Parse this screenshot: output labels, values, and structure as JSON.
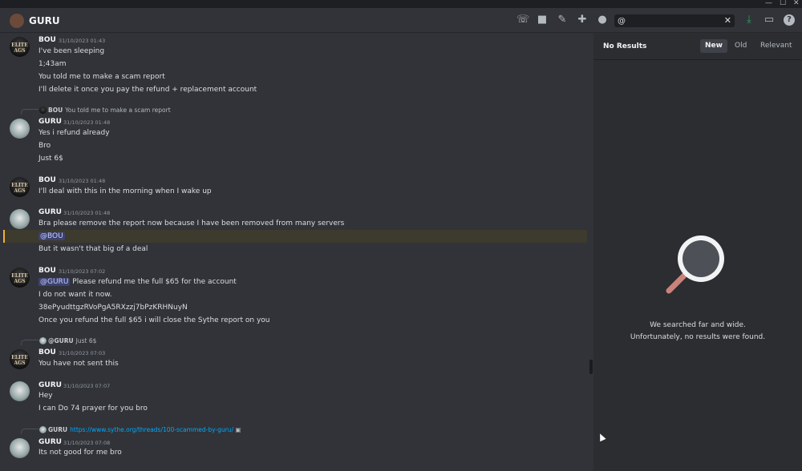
{
  "window": {
    "minimize": "—",
    "maximize": "☐",
    "close": "✕"
  },
  "header": {
    "title": "GURU",
    "icons": [
      "phone-icon",
      "video-icon",
      "pin-icon",
      "add-friend-icon",
      "profile-icon"
    ],
    "search_value": "@",
    "search_clear": "✕",
    "right_icons": [
      "download-icon",
      "inbox-icon",
      "help-icon"
    ]
  },
  "messages": [
    {
      "author": "BOU",
      "time": "31/10/2023 01:43",
      "lines": [
        "I've been sleeping",
        "1;43am",
        "You told me to make a scam report",
        "I'll delete it once you pay the refund + replacement account"
      ]
    },
    {
      "reply_author": "BOU",
      "reply_text": "You told me to make a scam report",
      "author": "GURU",
      "time": "31/10/2023 01:48",
      "lines": [
        "Yes i refund already",
        "Bro",
        "Just 6$"
      ]
    },
    {
      "author": "BOU",
      "time": "31/10/2023 01:48",
      "lines": [
        "I'll deal with this in the morning when I wake up"
      ]
    },
    {
      "author": "GURU",
      "time": "31/10/2023 01:48",
      "lines": [
        "Bra please remove the report now because I have been removed from many servers",
        "@BOU",
        "But it wasn't that big of a deal"
      ]
    },
    {
      "author": "BOU",
      "time": "31/10/2023 07:02",
      "mention": "@GURU",
      "lines": [
        "Please refund me the full $65 for the account",
        "I do not want it now.",
        "38ePyudttgzRVoPgA5RXzzj7bPzKRHNuyN",
        "Once you refund the full $65 i will close the Sythe report on you"
      ]
    },
    {
      "reply_author": "@GURU",
      "reply_text": "Just 6$",
      "author": "BOU",
      "time": "31/10/2023 07:03",
      "lines": [
        "You have not sent this"
      ]
    },
    {
      "author": "GURU",
      "time": "31/10/2023 07:07",
      "lines": [
        "Hey",
        "I can Do 74 prayer for you bro"
      ]
    },
    {
      "reply_author": "GURU",
      "reply_text": "https://www.sythe.org/threads/100-scammed-by-guru/",
      "author": "GURU",
      "time": "31/10/2023 07:08",
      "lines": [
        "Its not good for me bro"
      ]
    }
  ],
  "avatar_text": "ELITE AGS",
  "results": {
    "no_results": "No Results",
    "sort_new": "New",
    "sort_old": "Old",
    "sort_relevant": "Relevant",
    "empty_line1": "We searched far and wide.",
    "empty_line2": "Unfortunately, no results were found."
  },
  "colors": {
    "accent": "#00a8fc",
    "mention_bg": "#3c4270",
    "highlight": "#f0b232"
  }
}
